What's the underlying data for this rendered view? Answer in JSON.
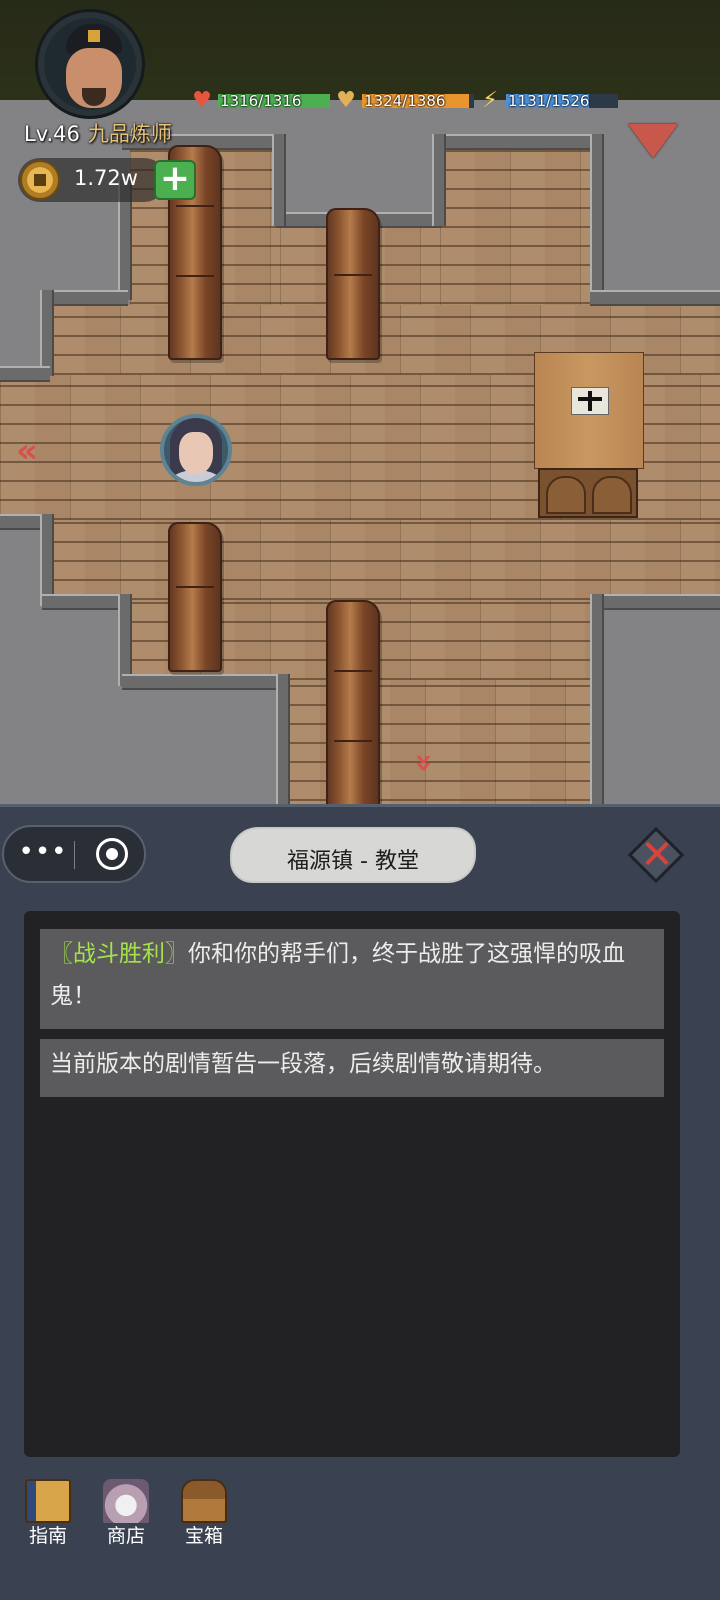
{
  "hud": {
    "hp": {
      "text": "1316/1316",
      "value": 1316,
      "max": 1316,
      "color": "#4caf50",
      "icon": "heart-icon"
    },
    "mp": {
      "text": "1324/1386",
      "value": 1324,
      "max": 1386,
      "color": "#e8952e",
      "icon": "broken-heart-icon"
    },
    "sp": {
      "text": "1131/1526",
      "value": 1131,
      "max": 1526,
      "color": "#4a90d9",
      "icon": "lightning-icon"
    },
    "level": "Lv.46",
    "title": "九品炼师",
    "currency": "1.72w",
    "add_label": "+"
  },
  "map": {
    "location": "福源镇 - 教堂",
    "exit_left_icon": "double-chevron-left-icon",
    "exit_down_icon": "double-chevron-down-icon"
  },
  "log": [
    {
      "tag": "〖战斗胜利〗",
      "text": "你和你的帮手们，终于战胜了这强悍的吸血鬼！"
    },
    {
      "tag": "",
      "text": "当前版本的剧情暂告一段落，后续剧情敬请期待。"
    }
  ],
  "toolbar": [
    {
      "label": "指南",
      "icon": "book-icon"
    },
    {
      "label": "商店",
      "icon": "shop-icon"
    },
    {
      "label": "宝箱",
      "icon": "chest-icon"
    }
  ],
  "colors": {
    "accent_green": "#a5e24a",
    "close_red": "#d8443c",
    "panel_bg": "#3a4150"
  }
}
